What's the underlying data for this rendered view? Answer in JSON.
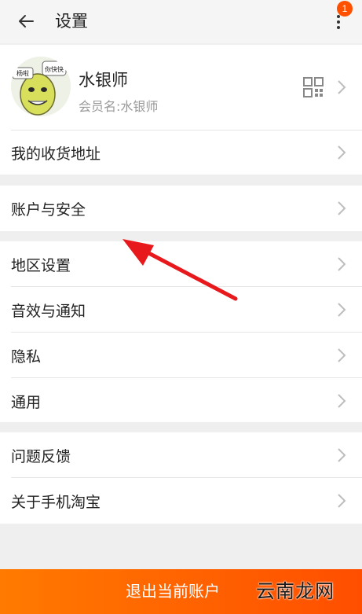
{
  "header": {
    "title": "设置",
    "notification_count": "1"
  },
  "profile": {
    "name": "水银师",
    "member_label": "会员名:水银师",
    "avatar_caption_top": "你快快",
    "avatar_caption_side": "杨啦"
  },
  "sections": [
    {
      "items": [
        {
          "label": "我的收货地址"
        }
      ]
    },
    {
      "items": [
        {
          "label": "账户与安全"
        }
      ]
    },
    {
      "items": [
        {
          "label": "地区设置"
        },
        {
          "label": "音效与通知"
        },
        {
          "label": "隐私"
        },
        {
          "label": "通用"
        }
      ]
    },
    {
      "items": [
        {
          "label": "问题反馈"
        },
        {
          "label": "关于手机淘宝"
        }
      ]
    }
  ],
  "footer": {
    "logout_label": "退出当前账户",
    "watermark": "云南龙网"
  },
  "colors": {
    "accent": "#ff5000",
    "annotation_arrow": "#e8191c"
  },
  "icons": [
    "back-arrow-icon",
    "more-vertical-icon",
    "qr-code-icon",
    "chevron-right-icon"
  ]
}
